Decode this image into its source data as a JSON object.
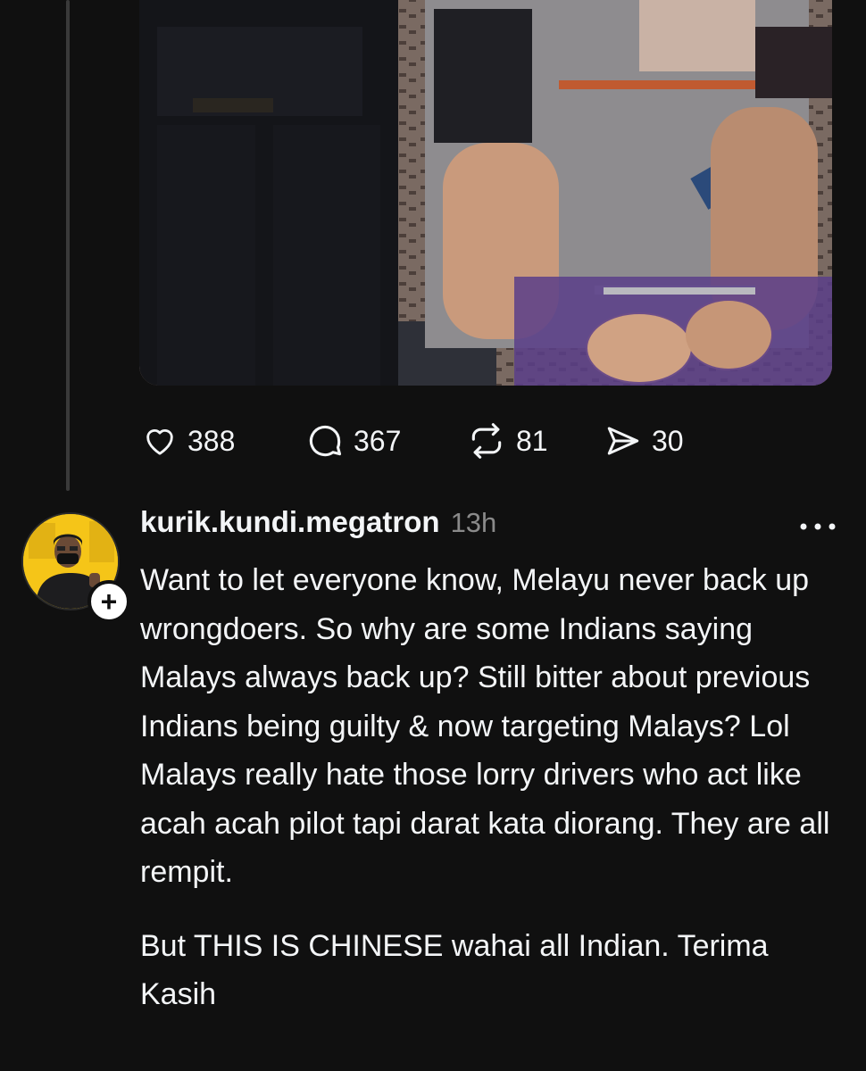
{
  "post": {
    "image_alt": "photo",
    "stats": {
      "likes": "388",
      "replies": "367",
      "reposts": "81",
      "shares": "30"
    }
  },
  "reply": {
    "username": "kurik.kundi.megatron",
    "timestamp": "13h",
    "follow_label": "+",
    "paragraphs": [
      "Want to let everyone know, Melayu never back up wrongdoers. So why are some Indians saying Malays always back up? Still bitter about previous Indians being guilty & now targeting Malays? Lol Malays really hate those lorry drivers who act like acah acah pilot tapi darat kata diorang. They are all rempit.",
      "But THIS IS CHINESE wahai all Indian. Terima Kasih"
    ]
  },
  "icons": {
    "like": "heart-icon",
    "reply": "comment-bubble-icon",
    "repost": "repost-arrows-icon",
    "share": "send-icon",
    "more": "ellipsis-icon"
  },
  "colors": {
    "background": "#101010",
    "text": "#f3f5f7",
    "muted": "#8a8a8a",
    "thread_line": "#3a3a3a",
    "avatar_bg": "#f5c518"
  }
}
